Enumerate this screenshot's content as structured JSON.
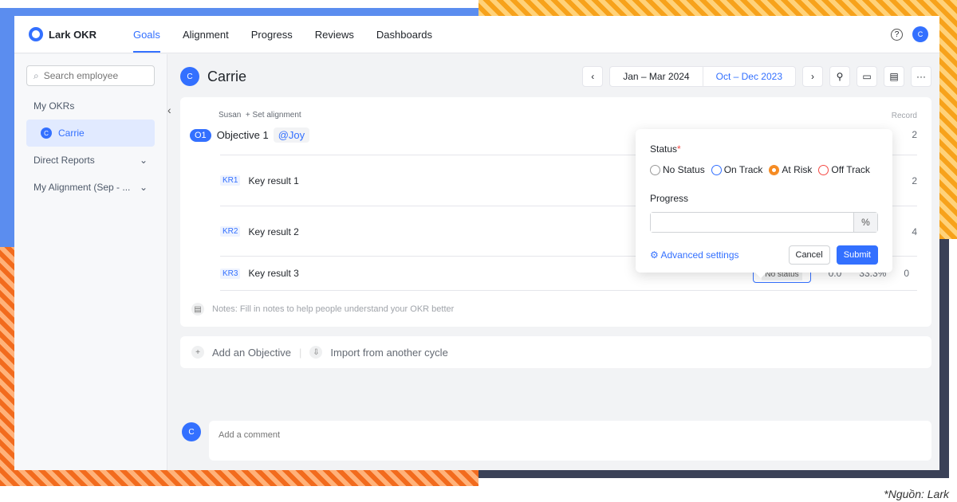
{
  "header": {
    "app_name": "Lark OKR",
    "nav": [
      "Goals",
      "Alignment",
      "Progress",
      "Reviews",
      "Dashboards"
    ],
    "active_nav": "Goals",
    "avatar_initial": "C"
  },
  "sidebar": {
    "search_placeholder": "Search employee",
    "items": [
      {
        "label": "My OKRs"
      },
      {
        "label": "Carrie",
        "initial": "C"
      },
      {
        "label": "Direct Reports"
      },
      {
        "label": "My Alignment (Sep - ..."
      }
    ]
  },
  "main": {
    "user_name": "Carrie",
    "user_initial": "C",
    "periods": [
      "Jan – Mar 2024",
      "Oct – Dec 2023"
    ],
    "current_period": "Oct – Dec 2023",
    "record_header": "Record",
    "objective": {
      "align_owner": "Susan",
      "set_alignment": "+ Set alignment",
      "badge": "O1",
      "title": "Objective 1",
      "mention": "@Joy",
      "record": "2"
    },
    "key_results": [
      {
        "badge": "KR1",
        "title": "Key result 1",
        "record": "2"
      },
      {
        "badge": "KR2",
        "title": "Key result 2",
        "record": "4"
      },
      {
        "badge": "KR3",
        "title": "Key result 3",
        "status": "No status",
        "score": "0.0",
        "progress": "33.3%",
        "record": "0"
      }
    ],
    "notes_placeholder": "Notes: Fill in notes to help people understand your OKR better",
    "add_objective": "Add an Objective",
    "import_cycle": "Import from another cycle",
    "comment_placeholder": "Add a comment"
  },
  "popover": {
    "status_label": "Status",
    "required_mark": "*",
    "options": [
      "No Status",
      "On Track",
      "At Risk",
      "Off Track"
    ],
    "selected": "At Risk",
    "option_colors": [
      "#999999",
      "#3370ff",
      "#f5891f",
      "#f54a45"
    ],
    "progress_label": "Progress",
    "progress_value": "",
    "unit": "%",
    "advanced": "Advanced settings",
    "cancel": "Cancel",
    "submit": "Submit"
  },
  "caption": "*Nguồn: Lark"
}
